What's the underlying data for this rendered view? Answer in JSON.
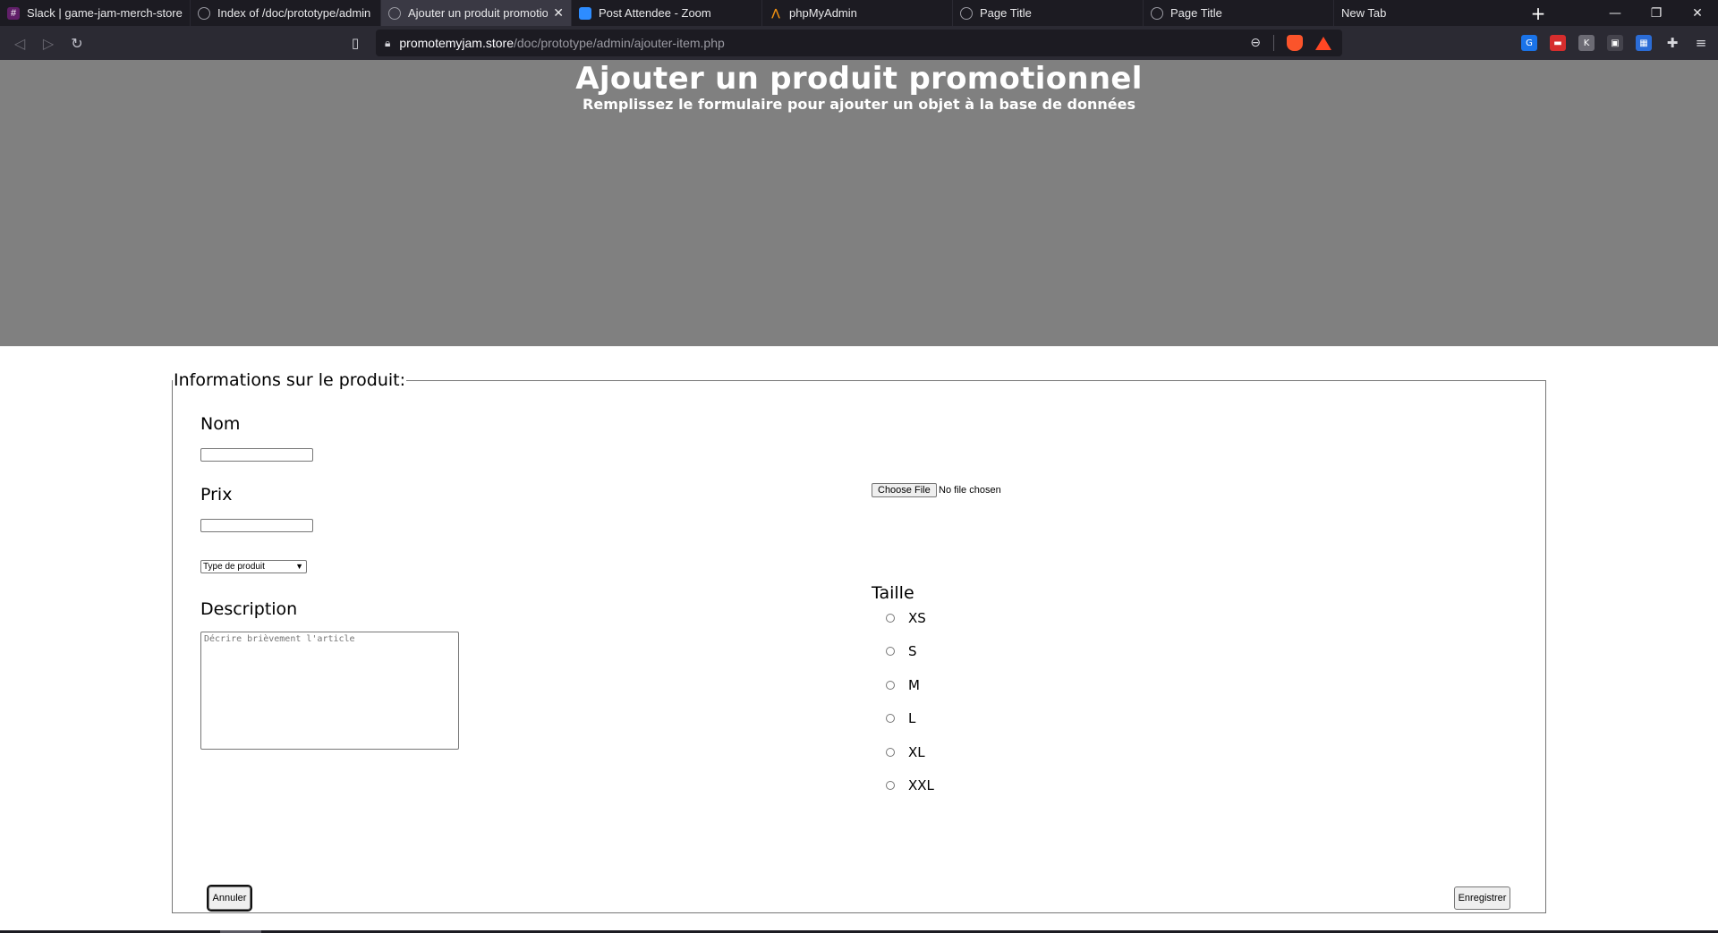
{
  "browser": {
    "tabs": [
      {
        "label": "Slack | game-jam-merch-store | C",
        "icon": "slack-icon"
      },
      {
        "label": "Index of /doc/prototype/admin",
        "icon": "globe-icon"
      },
      {
        "label": "Ajouter un produit promotio",
        "icon": "globe-icon",
        "active": true
      },
      {
        "label": "Post Attendee - Zoom",
        "icon": "zoom-icon"
      },
      {
        "label": "phpMyAdmin",
        "icon": "phpmyadmin-icon"
      },
      {
        "label": "Page Title",
        "icon": "globe-icon"
      },
      {
        "label": "Page Title",
        "icon": "globe-icon"
      },
      {
        "label": "New Tab",
        "icon": ""
      }
    ],
    "url_host": "promotemyjam.store",
    "url_path": "/doc/prototype/admin/ajouter-item.php",
    "accent_brave": "#fb542b"
  },
  "page": {
    "title": "Ajouter un produit promotionnel",
    "subtitle": "Remplissez le formulaire pour ajouter un objet à la base de données",
    "hero_color": "#808080",
    "form": {
      "legend": "Informations sur le produit:",
      "nom_label": "Nom",
      "nom_value": "",
      "prix_label": "Prix",
      "prix_value": "",
      "type_select_value": "Type de produit",
      "description_label": "Description",
      "description_placeholder": "Décrire brièvement l'article",
      "file_button": "Choose File",
      "file_status": "No file chosen",
      "taille_label": "Taille",
      "sizes": [
        "XS",
        "S",
        "M",
        "L",
        "XL",
        "XXL"
      ],
      "cancel_button": "Annuler",
      "save_button": "Enregistrer"
    }
  }
}
